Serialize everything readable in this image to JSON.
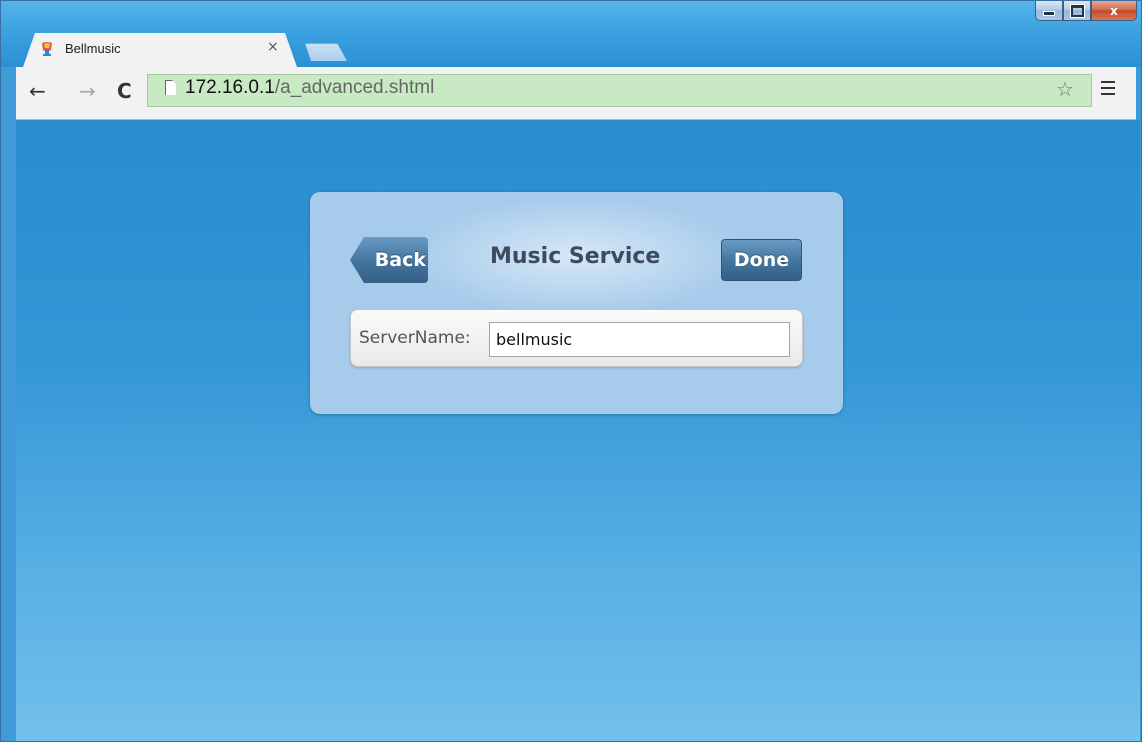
{
  "browser": {
    "tab": {
      "title": "Bellmusic",
      "close_glyph": "×",
      "favicon": "bellmusic-favicon-icon"
    },
    "new_tab_icon": "new-tab-icon",
    "window_controls": {
      "minimize_icon": "minimize-icon",
      "maximize_icon": "maximize-icon",
      "close_glyph": "x"
    },
    "toolbar": {
      "back_glyph": "←",
      "forward_glyph": "→",
      "reload_glyph": "C",
      "url_host": "172.16.0.1",
      "url_path": "/a_advanced.shtml",
      "star_glyph": "☆",
      "menu_icon": "menu-icon",
      "omnibox_color": "#c8e9c4"
    }
  },
  "page": {
    "back_label": "Back",
    "title": "Music Service",
    "done_label": "Done",
    "server_name_label": "ServerName:",
    "server_name_value": "bellmusic",
    "accent_color": "#44769f",
    "panel_color": "#a6cbeb"
  }
}
